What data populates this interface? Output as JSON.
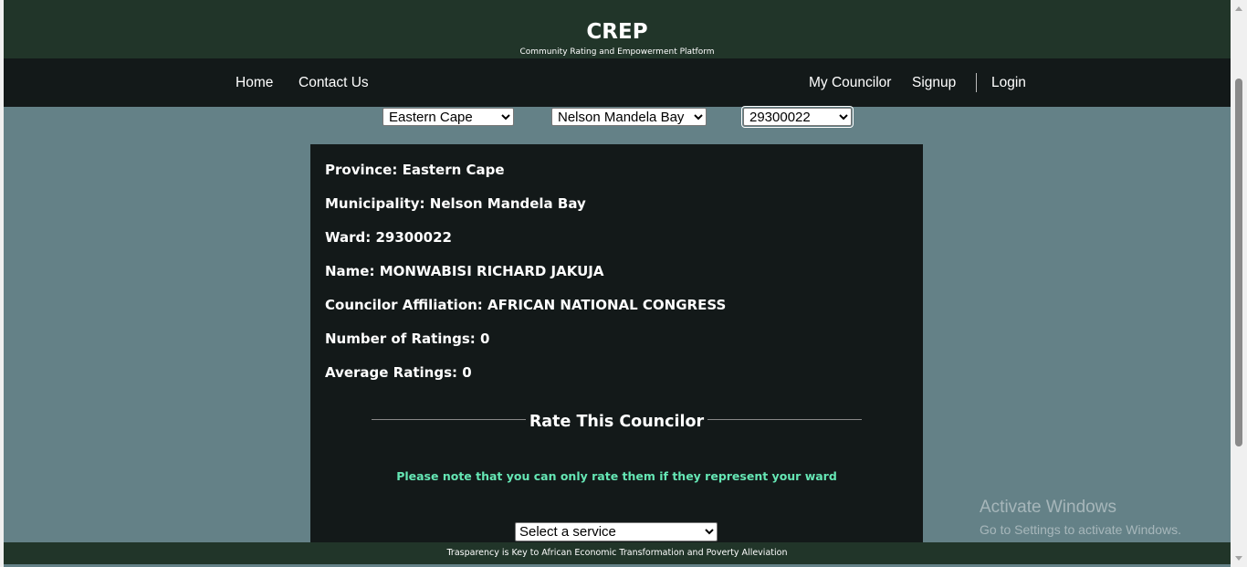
{
  "header": {
    "title": "CREP",
    "subtitle": "Community Rating and Empowerment Platform"
  },
  "nav": {
    "home": "Home",
    "contact": "Contact Us",
    "my_councilor": "My Councilor",
    "signup": "Signup",
    "login": "Login"
  },
  "filters": {
    "province": "Eastern Cape",
    "municipality": "Nelson Mandela Bay",
    "ward": "29300022"
  },
  "councilor": {
    "province": "Province: Eastern Cape",
    "municipality": "Municipality: Nelson Mandela Bay",
    "ward": "Ward: 29300022",
    "name": "Name: MONWABISI RICHARD JAKUJA",
    "affiliation": "Councilor Affiliation: AFRICAN NATIONAL CONGRESS",
    "num_ratings": "Number of Ratings: 0",
    "avg_rating": "Average Ratings: 0"
  },
  "rating": {
    "title": "Rate This Councilor",
    "note": "Please note that you can only rate them if they represent your ward",
    "service_placeholder": "Select a service"
  },
  "footer": {
    "text": "Trasparency is Key to African Economic Transformation and Poverty Alleviation"
  },
  "watermark": {
    "title": "Activate Windows",
    "subtitle": "Go to Settings to activate Windows."
  },
  "colors": {
    "header_bg": "#213529",
    "nav_bg": "#131919",
    "page_bg": "#648187",
    "note_accent": "#65e6b4"
  }
}
